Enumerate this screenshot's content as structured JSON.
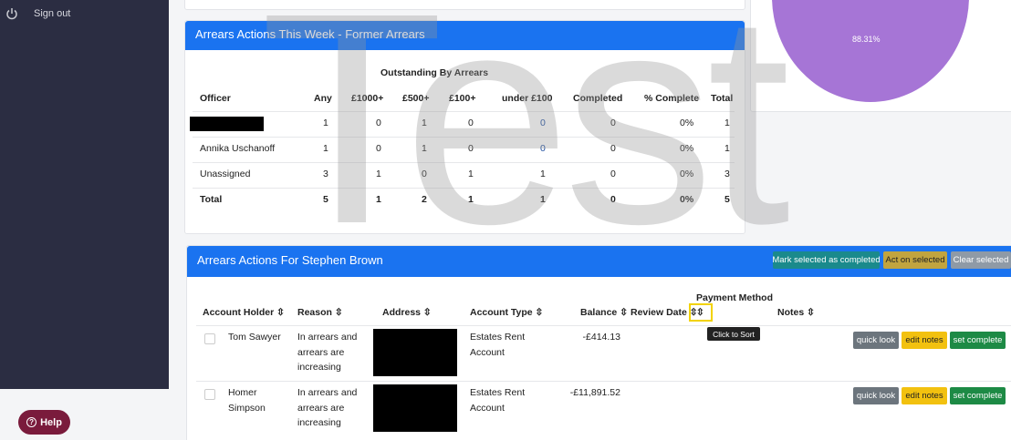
{
  "sidebar": {
    "signout_label": "Sign out",
    "help_label": "Help"
  },
  "watermark": "Test",
  "pie": {
    "label": "88.31%",
    "color": "#a675d6"
  },
  "former": {
    "title": "Arrears Actions This Week - Former Arrears",
    "group_header": "Outstanding By Arrears",
    "headers": [
      "Officer",
      "Any",
      "£1000+",
      "£500+",
      "£100+",
      "under £100",
      "Completed",
      "% Complete",
      "Total"
    ],
    "rows": [
      [
        "",
        "1",
        "0",
        "1",
        "0",
        "0",
        "0",
        "0%",
        "1"
      ],
      [
        "Annika Uschanoff",
        "1",
        "0",
        "1",
        "0",
        "0",
        "0",
        "0%",
        "1"
      ],
      [
        "Unassigned",
        "3",
        "1",
        "0",
        "1",
        "1",
        "0",
        "0%",
        "3"
      ],
      [
        "Total",
        "5",
        "1",
        "2",
        "1",
        "1",
        "0",
        "0%",
        "5"
      ]
    ]
  },
  "actions": {
    "title": "Arrears Actions For Stephen Brown",
    "mark_completed": "Mark selected as completed",
    "act_on_selected": "Act on selected",
    "clear_selected": "Clear selected",
    "headers": {
      "holder": "Account Holder ⇳",
      "reason": "Reason ⇳",
      "address": "Address ⇳",
      "type": "Account Type ⇳",
      "balance": "Balance ⇳",
      "review": "Review Date ⇳",
      "payment": "Payment Method",
      "payment_sort": "⇳",
      "notes": "Notes ⇳"
    },
    "tooltip": "Click to Sort",
    "rows": [
      {
        "holder": "Tom Sawyer",
        "reason": "In arrears and arrears are increasing",
        "type": "Estates Rent Account",
        "balance": "-£414.13"
      },
      {
        "holder": "Homer Simpson",
        "reason": "In arrears and arrears are increasing",
        "type": "Estates Rent Account",
        "balance": "-£11,891.52"
      }
    ],
    "buttons": {
      "quick_look": "quick look",
      "edit_notes": "edit notes",
      "set_complete": "set complete"
    }
  }
}
